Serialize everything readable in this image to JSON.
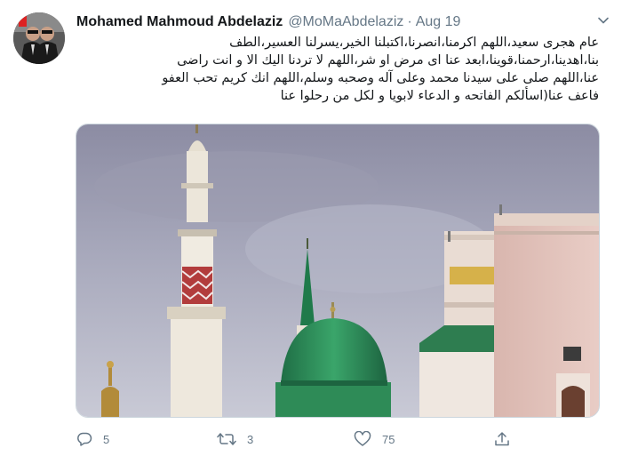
{
  "tweet": {
    "author_name": "Mohamed Mahmoud Abdelaziz",
    "handle": "@MoMaAbdelaziz",
    "separator": "·",
    "date": "Aug 19",
    "text_lines": [
      "عام هجرى سعيد،اللهم اكرمنا،انصرنا،اكتبلنا الخير،يسرلنا العسير،الطف",
      "بنا،اهدينا،ارحمنا،قوينا،ابعد عنا اى مرض او شر،اللهم لا تردنا اليك الا و انت راضى",
      "عنا،اللهم صلى على سيدنا محمد وعلى آله وصحبه وسلم،اللهم انك كريم تحب العفو",
      "فاعف عنا(اسألكم الفاتحه و الدعاء لابويا و لكل من رحلوا عنا"
    ],
    "media_icon": "photo-mosque-green-dome",
    "actions": {
      "reply_count": "5",
      "retweet_count": "3",
      "like_count": "75"
    }
  },
  "icons": {
    "caret": "chevron-down-icon",
    "reply": "reply-icon",
    "retweet": "retweet-icon",
    "like": "heart-icon",
    "share": "share-icon"
  },
  "colors": {
    "secondary_text": "#657786",
    "dome_green": "#2e8b57",
    "sky": "#a9aabd"
  }
}
